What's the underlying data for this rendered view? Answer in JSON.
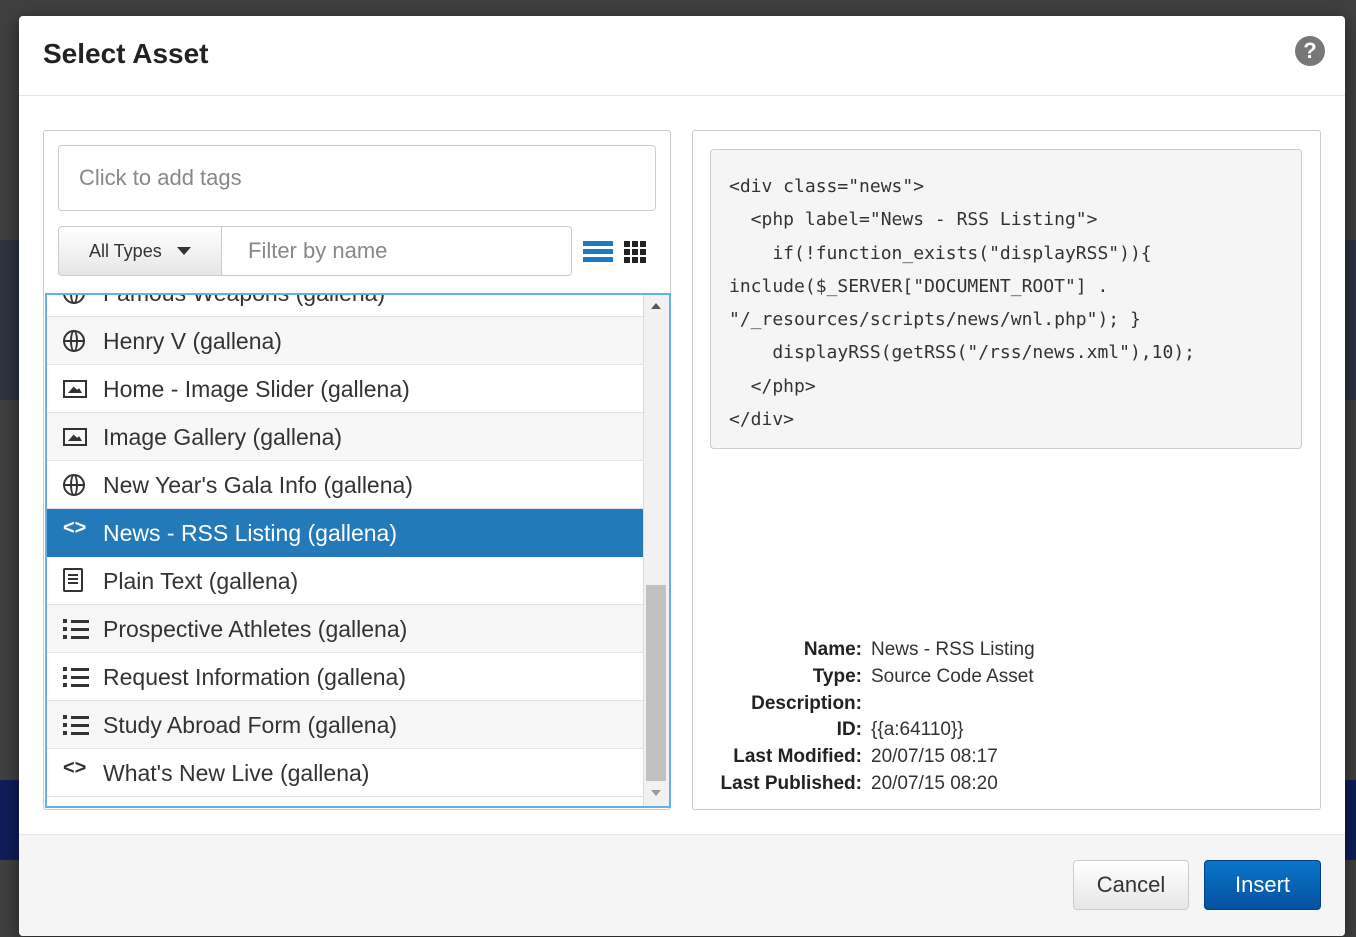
{
  "dialog": {
    "title": "Select Asset",
    "help_icon": "question-circle-icon",
    "cancel_label": "Cancel",
    "insert_label": "Insert"
  },
  "filters": {
    "tags_placeholder": "Click to add tags",
    "types_label": "All Types",
    "name_placeholder": "Filter by name",
    "view_icons": [
      "list-view-icon",
      "grid-view-icon"
    ]
  },
  "assets": [
    {
      "label": "Famous Weapons (gallena)",
      "icon": "globe-icon",
      "selected": false
    },
    {
      "label": "Henry V (gallena)",
      "icon": "globe-icon",
      "selected": false
    },
    {
      "label": "Home - Image Slider (gallena)",
      "icon": "image-icon",
      "selected": false
    },
    {
      "label": "Image Gallery (gallena)",
      "icon": "image-icon",
      "selected": false
    },
    {
      "label": "New Year's Gala Info (gallena)",
      "icon": "globe-icon",
      "selected": false
    },
    {
      "label": "News - RSS Listing (gallena)",
      "icon": "code-icon",
      "selected": true
    },
    {
      "label": "Plain Text (gallena)",
      "icon": "document-icon",
      "selected": false
    },
    {
      "label": "Prospective Athletes (gallena)",
      "icon": "list-icon",
      "selected": false
    },
    {
      "label": "Request Information (gallena)",
      "icon": "list-icon",
      "selected": false
    },
    {
      "label": "Study Abroad Form (gallena)",
      "icon": "list-icon",
      "selected": false
    },
    {
      "label": "What's New Live (gallena)",
      "icon": "code-icon",
      "selected": false
    }
  ],
  "preview": {
    "code": "<div class=\"news\">\n  <php label=\"News - RSS Listing\">\n    if(!function_exists(\"displayRSS\")){\ninclude($_SERVER[\"DOCUMENT_ROOT\"] .\n\"/_resources/scripts/news/wnl.php\"); }\n    displayRSS(getRSS(\"/rss/news.xml\"),10);\n  </php>\n</div>"
  },
  "details": [
    {
      "label": "Name:",
      "value": "News - RSS Listing"
    },
    {
      "label": "Type:",
      "value": "Source Code Asset"
    },
    {
      "label": "Description:",
      "value": ""
    },
    {
      "label": "ID:",
      "value": "{{a:64110}}"
    },
    {
      "label": "Last Modified:",
      "value": "20/07/15 08:17"
    },
    {
      "label": "Last Published:",
      "value": "20/07/15 08:20"
    }
  ],
  "colors": {
    "accent": "#2479b9",
    "primary_button": "#0651a1",
    "focus_border": "#66afe9"
  }
}
